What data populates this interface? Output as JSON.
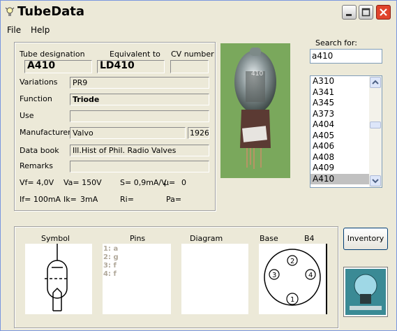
{
  "window": {
    "title": "TubeData"
  },
  "menu": {
    "file": "File",
    "help": "Help"
  },
  "fields": {
    "tube_designation_label": "Tube designation",
    "tube_designation": "A410",
    "equivalent_label": "Equivalent to",
    "equivalent": "LD410",
    "cv_label": "CV number",
    "cv": "",
    "variations_label": "Variations",
    "variations": "PR9",
    "function_label": "Function",
    "function": "Triode",
    "use_label": "Use",
    "use": "",
    "manufacturer_label": "Manufacturer",
    "manufacturer": "Valvo",
    "year": "1926",
    "databook_label": "Data book",
    "databook": "Ill.Hist of Phil. Radio Valves",
    "remarks_label": "Remarks",
    "remarks": ""
  },
  "specs": {
    "vf": "Vf= 4,0V",
    "va": "Va= 150V",
    "s": "S= 0,9mA/V",
    "mu": "µ=",
    "mu_val": "0",
    "if": "If= 100mA",
    "ik": "Ik=",
    "ik_val": "3mA",
    "ri": "Ri=",
    "pa": "Pa="
  },
  "search": {
    "label": "Search for:",
    "value": "a410",
    "items": [
      "A310",
      "A341",
      "A345",
      "A373",
      "A404",
      "A405",
      "A406",
      "A408",
      "A409",
      "A410"
    ],
    "selected_index": 9
  },
  "bottom": {
    "symbol_label": "Symbol",
    "pins_label": "Pins",
    "diagram_label": "Diagram",
    "base_label": "Base",
    "base_type": "B4",
    "pins": [
      "1: a",
      "2: g",
      "3: f",
      "4: f"
    ],
    "base_pins": [
      "2",
      "3",
      "4",
      "1"
    ]
  },
  "photo_marking": "410",
  "inventory_button": "Inventory",
  "colors": {
    "selection": "#c1c1c1",
    "window_bg": "#ece9d8",
    "close_red": "#e0442c",
    "photo_bg": "#7aa85c"
  }
}
